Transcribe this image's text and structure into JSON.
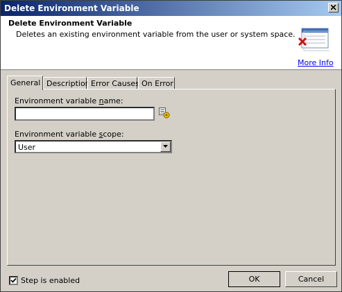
{
  "window": {
    "title": "Delete Environment Variable"
  },
  "header": {
    "title": "Delete Environment Variable",
    "description": "Deletes an existing environment variable from the user or system space.",
    "more_info": "More Info"
  },
  "tabs": [
    {
      "label": "General",
      "active": true
    },
    {
      "label": "Description",
      "active": false
    },
    {
      "label": "Error Causes",
      "active": false
    },
    {
      "label": "On Error",
      "active": false
    }
  ],
  "general": {
    "name_label_pre": "Environment variable ",
    "name_label_accel": "n",
    "name_label_post": "ame:",
    "name_value": "",
    "scope_label_pre": "Environment variable ",
    "scope_label_accel": "s",
    "scope_label_post": "cope:",
    "scope_value": "User"
  },
  "footer": {
    "step_enabled_label": "Step is enabled",
    "step_enabled_checked": true,
    "ok_label": "OK",
    "cancel_label": "Cancel"
  },
  "icons": {
    "close": "close-icon",
    "header": "delete-variable-icon",
    "variable_picker": "variable-picker-icon",
    "dropdown": "chevron-down-icon",
    "check": "checkmark-icon"
  }
}
